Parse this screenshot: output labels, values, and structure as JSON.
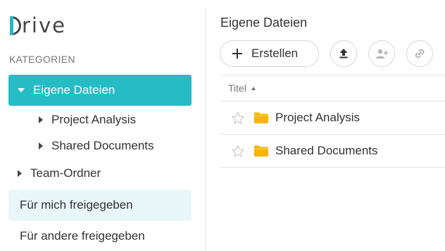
{
  "app": {
    "logo_text": "rive"
  },
  "sidebar": {
    "category_label": "KATEGORIEN",
    "items": [
      {
        "label": "Eigene Dateien"
      },
      {
        "label": "Project Analysis"
      },
      {
        "label": "Shared Documents"
      },
      {
        "label": "Team-Ordner"
      },
      {
        "label": "Für mich freigegeben"
      },
      {
        "label": "Für andere freigegeben"
      }
    ]
  },
  "main": {
    "title": "Eigene Dateien",
    "toolbar": {
      "create_label": "Erstellen"
    },
    "column_title": "Titel",
    "files": [
      {
        "name": "Project Analysis"
      },
      {
        "name": "Shared Documents"
      }
    ]
  },
  "colors": {
    "accent": "#26bcc6",
    "soft_accent": "#e8f6f7",
    "folder": "#f7b500",
    "icons": [
      "upload-icon",
      "add-user-icon",
      "link-icon",
      "star-icon",
      "folder-icon"
    ]
  }
}
